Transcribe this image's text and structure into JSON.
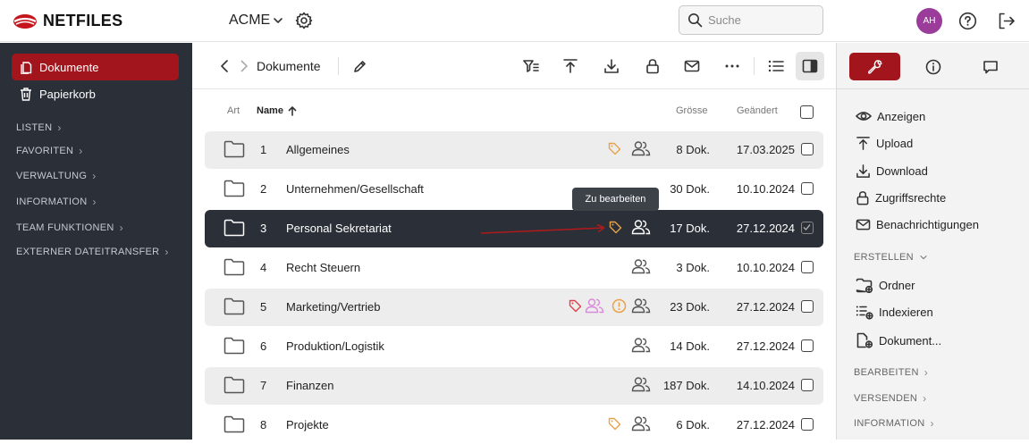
{
  "app": {
    "logo_text": "NETFILES",
    "workspace": "ACME",
    "search_placeholder": "Suche",
    "user_initials": "AH",
    "brand_color": "#a3151c",
    "sidebar_color": "#2a2f38"
  },
  "sidebar": {
    "items": [
      {
        "label": "Dokumente",
        "icon": "documents-icon"
      },
      {
        "label": "Papierkorb",
        "icon": "trash-icon"
      }
    ],
    "sections": [
      "LISTEN",
      "FAVORITEN",
      "VERWALTUNG",
      "INFORMATION",
      "TEAM FUNKTIONEN",
      "EXTERNER DATEITRANSFER"
    ]
  },
  "toolbar": {
    "breadcrumb": "Dokumente"
  },
  "table": {
    "headers": {
      "type": "Art",
      "name": "Name",
      "size": "Grösse",
      "changed": "Geändert"
    },
    "rows": [
      {
        "num": "1",
        "name": "Allgemeines",
        "size": "8 Dok.",
        "date": "17.03.2025"
      },
      {
        "num": "2",
        "name": "Unternehmen/Gesellschaft",
        "size": "30 Dok.",
        "date": "10.10.2024"
      },
      {
        "num": "3",
        "name": "Personal Sekretariat",
        "size": "17 Dok.",
        "date": "27.12.2024"
      },
      {
        "num": "4",
        "name": "Recht Steuern",
        "size": "3 Dok.",
        "date": "10.10.2024"
      },
      {
        "num": "5",
        "name": "Marketing/Vertrieb",
        "size": "23 Dok.",
        "date": "27.12.2024"
      },
      {
        "num": "6",
        "name": "Produktion/Logistik",
        "size": "14 Dok.",
        "date": "27.12.2024"
      },
      {
        "num": "7",
        "name": "Finanzen",
        "size": "187 Dok.",
        "date": "14.10.2024"
      },
      {
        "num": "8",
        "name": "Projekte",
        "size": "6 Dok.",
        "date": "27.12.2024"
      }
    ],
    "tooltip": "Zu bearbeiten"
  },
  "panel": {
    "actions": [
      "Anzeigen",
      "Upload",
      "Download",
      "Zugriffsrechte",
      "Benachrichtigungen"
    ],
    "create_section": "ERSTELLEN",
    "create_items": [
      "Ordner",
      "Indexieren",
      "Dokument..."
    ],
    "sections": [
      "BEARBEITEN",
      "VERSENDEN",
      "INFORMATION"
    ]
  }
}
